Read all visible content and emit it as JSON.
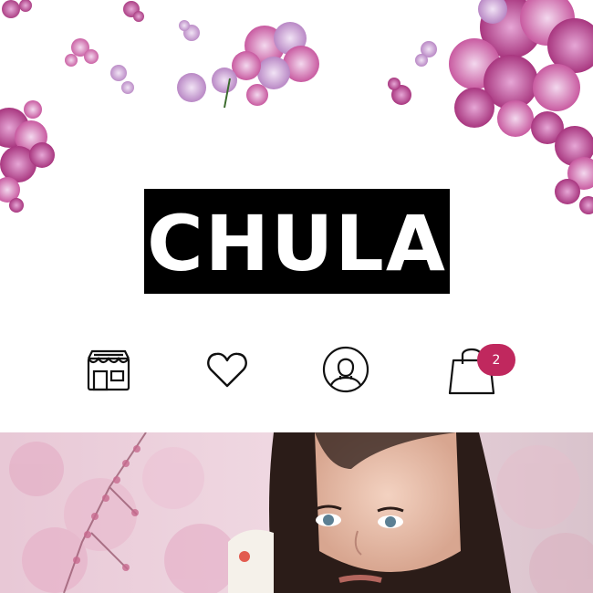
{
  "brand": {
    "logo_text": "CHULA",
    "logo_background": "#000000",
    "logo_color": "#ffffff"
  },
  "nav_icons": [
    {
      "name": "store-icon"
    },
    {
      "name": "heart-icon"
    },
    {
      "name": "profile-icon"
    },
    {
      "name": "shopping-bag-icon"
    }
  ],
  "cart": {
    "badge_count": "2",
    "badge_color": "#c0285e"
  },
  "colors": {
    "accent": "#c0285e",
    "flower": "#c86aa8",
    "flower_light": "#e6b6dc"
  }
}
